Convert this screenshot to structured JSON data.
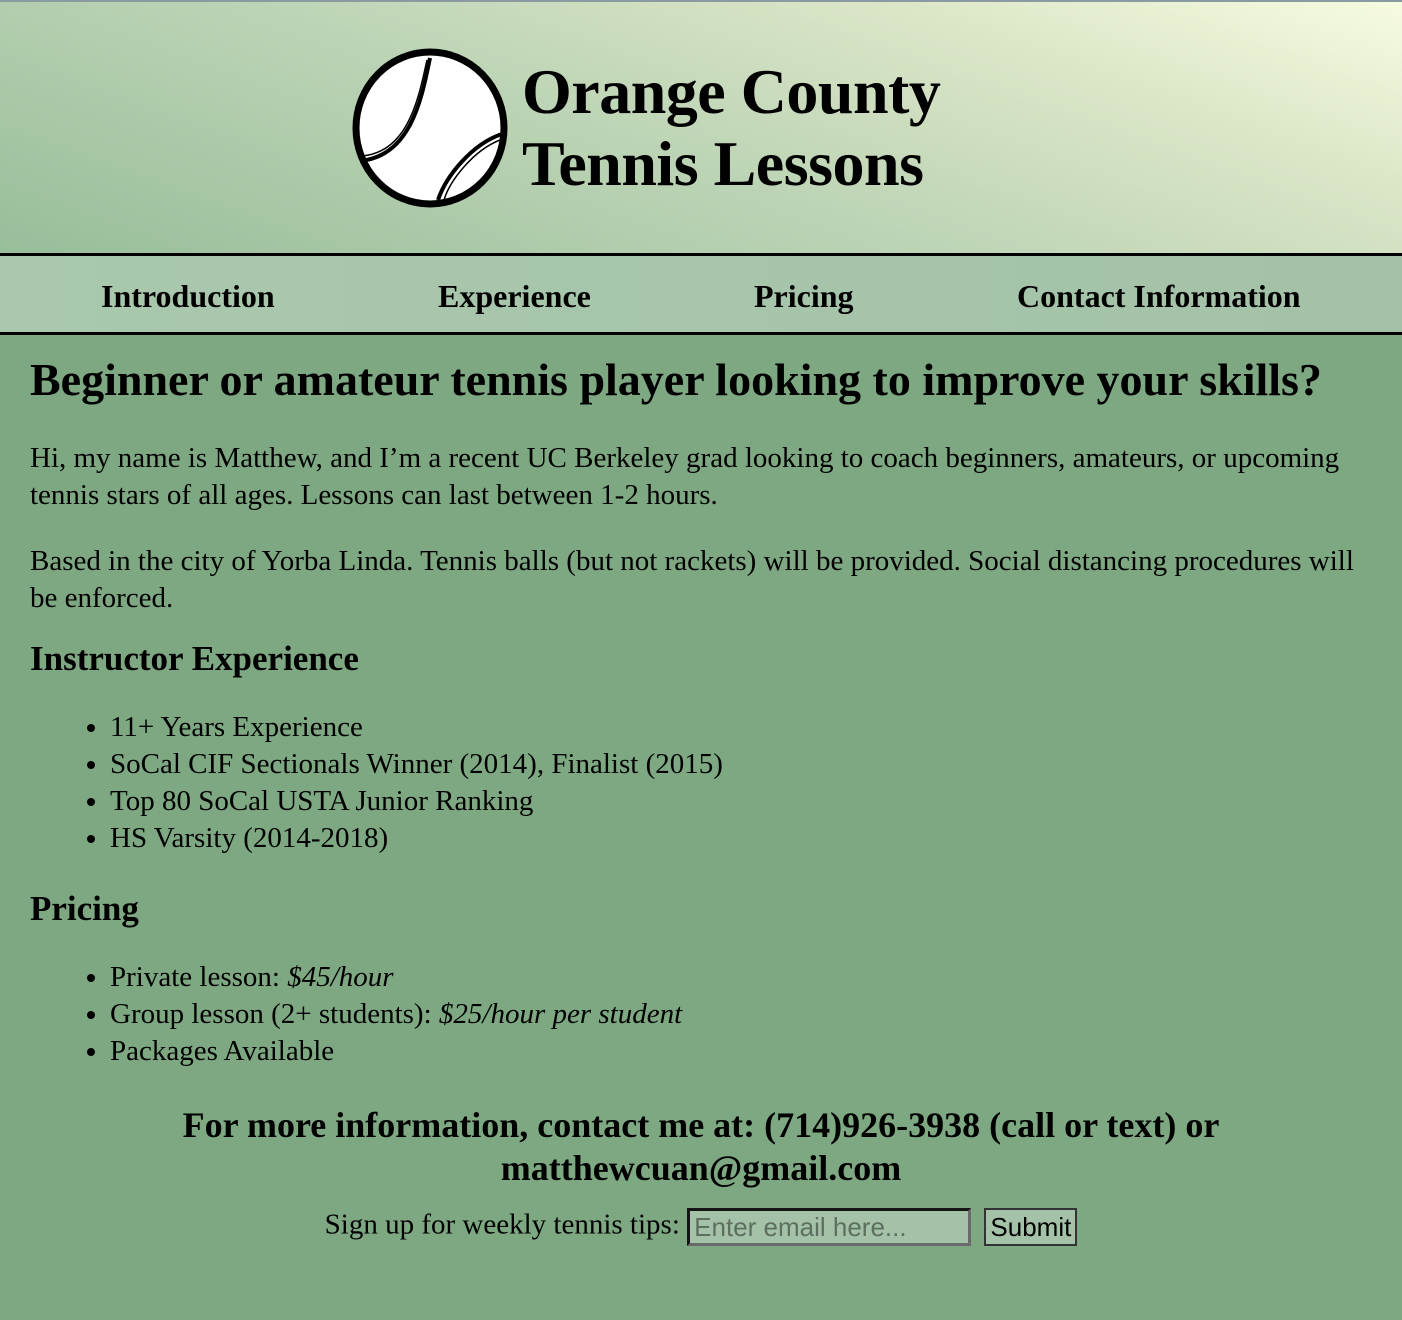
{
  "header": {
    "title_line1": "Orange County",
    "title_line2": "Tennis Lessons",
    "logo_icon": "tennis-ball-icon"
  },
  "nav": {
    "items": [
      {
        "label": "Introduction"
      },
      {
        "label": "Experience"
      },
      {
        "label": "Pricing"
      },
      {
        "label": "Contact Information"
      }
    ]
  },
  "intro": {
    "heading": "Beginner or amateur tennis player looking to improve your skills?",
    "paragraph1": "Hi, my name is Matthew, and I’m a recent UC Berkeley grad looking to coach beginners, amateurs, or upcoming tennis stars of all ages. Lessons can last between 1-2 hours.",
    "paragraph2": "Based in the city of Yorba Linda. Tennis balls (but not rackets) will be provided. Social distancing procedures will be enforced."
  },
  "experience": {
    "heading": "Instructor Experience",
    "items": [
      "11+ Years Experience",
      "SoCal CIF Sectionals Winner (2014), Finalist (2015)",
      "Top 80 SoCal USTA Junior Ranking",
      "HS Varsity (2014-2018)"
    ]
  },
  "pricing": {
    "heading": "Pricing",
    "items": [
      {
        "label": "Private lesson: ",
        "price": "$45/hour"
      },
      {
        "label": "Group lesson (2+ students): ",
        "price": "$25/hour per student"
      },
      {
        "label": "Packages Available",
        "price": ""
      }
    ]
  },
  "contact": {
    "text": "For more information, contact me at: (714)926-3938 (call or text) or matthewcuan@gmail.com"
  },
  "signup": {
    "label": "Sign up for weekly tennis tips:",
    "placeholder": "Enter email here...",
    "value": "",
    "submit_label": "Submit"
  },
  "colors": {
    "page_background": "#7da882",
    "nav_background": "#a3c2a8",
    "header_gradient_light": "#f6fbe0",
    "header_gradient_dark": "#98bd99"
  }
}
